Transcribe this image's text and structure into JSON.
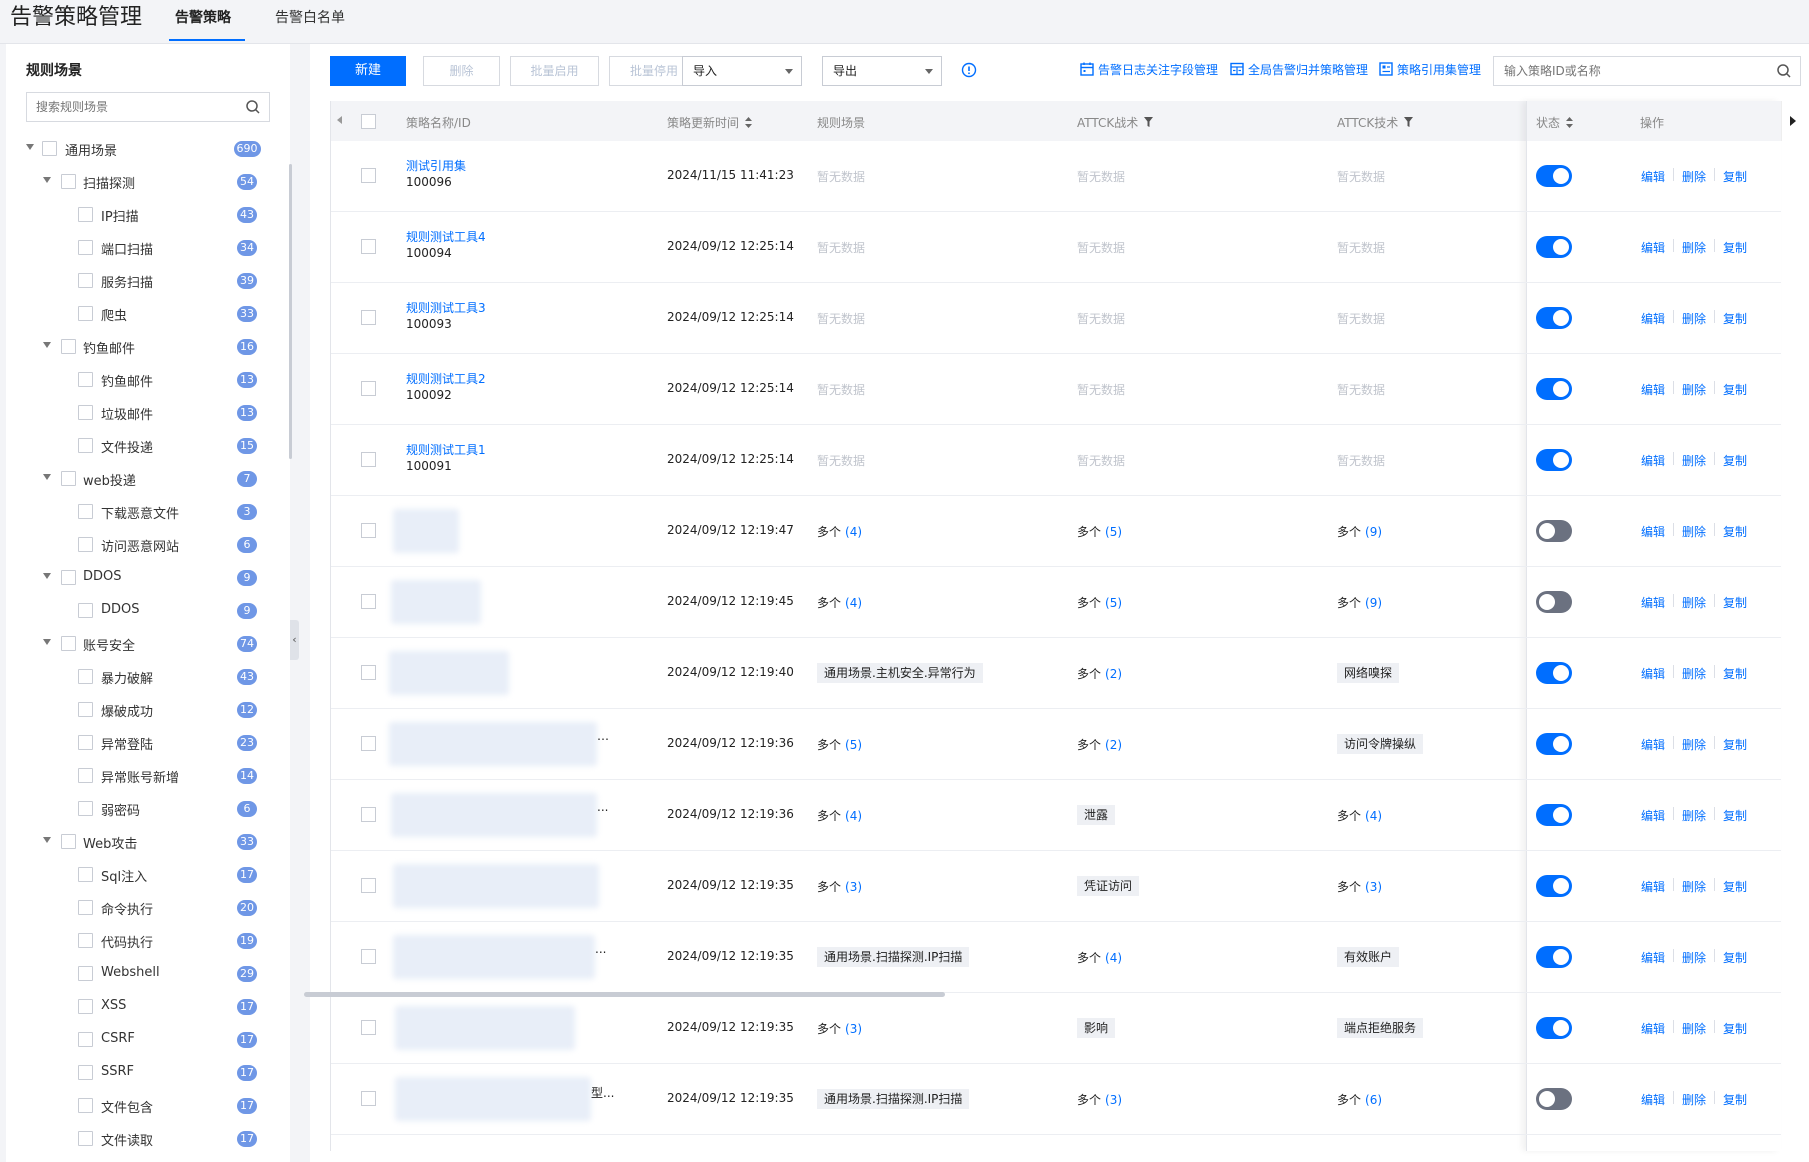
{
  "app_title": "告警策略管理",
  "tabs": [
    {
      "label": "告警策略",
      "active": true
    },
    {
      "label": "告警白名单",
      "active": false
    }
  ],
  "sidebar": {
    "title": "规则场景",
    "search_placeholder": "搜索规则场景",
    "tree": [
      {
        "label": "通用场景",
        "count": "690",
        "level": 0,
        "caret": true
      },
      {
        "label": "扫描探测",
        "count": "54",
        "level": 1,
        "caret": true
      },
      {
        "label": "IP扫描",
        "count": "43",
        "level": 2
      },
      {
        "label": "端口扫描",
        "count": "34",
        "level": 2
      },
      {
        "label": "服务扫描",
        "count": "39",
        "level": 2
      },
      {
        "label": "爬虫",
        "count": "33",
        "level": 2
      },
      {
        "label": "钓鱼邮件",
        "count": "16",
        "level": 1,
        "caret": true
      },
      {
        "label": "钓鱼邮件",
        "count": "13",
        "level": 2
      },
      {
        "label": "垃圾邮件",
        "count": "13",
        "level": 2
      },
      {
        "label": "文件投递",
        "count": "15",
        "level": 2
      },
      {
        "label": "web投递",
        "count": "7",
        "level": 1,
        "caret": true
      },
      {
        "label": "下载恶意文件",
        "count": "3",
        "level": 2
      },
      {
        "label": "访问恶意网站",
        "count": "6",
        "level": 2
      },
      {
        "label": "DDOS",
        "count": "9",
        "level": 1,
        "caret": true
      },
      {
        "label": "DDOS",
        "count": "9",
        "level": 2
      },
      {
        "label": "账号安全",
        "count": "74",
        "level": 1,
        "caret": true
      },
      {
        "label": "暴力破解",
        "count": "43",
        "level": 2
      },
      {
        "label": "爆破成功",
        "count": "12",
        "level": 2
      },
      {
        "label": "异常登陆",
        "count": "23",
        "level": 2
      },
      {
        "label": "异常账号新增",
        "count": "14",
        "level": 2
      },
      {
        "label": "弱密码",
        "count": "6",
        "level": 2
      },
      {
        "label": "Web攻击",
        "count": "33",
        "level": 1,
        "caret": true
      },
      {
        "label": "Sql注入",
        "count": "17",
        "level": 2
      },
      {
        "label": "命令执行",
        "count": "20",
        "level": 2
      },
      {
        "label": "代码执行",
        "count": "19",
        "level": 2
      },
      {
        "label": "Webshell",
        "count": "29",
        "level": 2
      },
      {
        "label": "XSS",
        "count": "17",
        "level": 2
      },
      {
        "label": "CSRF",
        "count": "17",
        "level": 2
      },
      {
        "label": "SSRF",
        "count": "17",
        "level": 2
      },
      {
        "label": "文件包含",
        "count": "17",
        "level": 2
      },
      {
        "label": "文件读取",
        "count": "17",
        "level": 2
      }
    ]
  },
  "toolbar": {
    "new_label": "新建",
    "delete_label": "删除",
    "batch_enable_label": "批量启用",
    "batch_disable_label": "批量停用",
    "import_label": "导入",
    "export_label": "导出",
    "link_field_mgmt": "告警日志关注字段管理",
    "link_merge_mgmt": "全局告警归并策略管理",
    "link_ref_mgmt": "策略引用集管理",
    "search_placeholder": "输入策略ID或名称"
  },
  "table": {
    "columns": {
      "name": "策略名称/ID",
      "updated": "策略更新时间",
      "scene": "规则场景",
      "tactic": "ATTCK战术",
      "technique": "ATTCK技术",
      "status": "状态",
      "actions": "操作"
    },
    "action_labels": {
      "edit": "编辑",
      "delete": "删除",
      "copy": "复制"
    },
    "nodata": "暂无数据",
    "multi_prefix": "多个",
    "rows": [
      {
        "name": "测试引用集",
        "id": "100096",
        "time": "2024/11/15 11:41:23",
        "scene": {
          "nodata": true
        },
        "tactic": {
          "nodata": true
        },
        "tech": {
          "nodata": true
        },
        "on": true
      },
      {
        "name": "规则测试工具4",
        "id": "100094",
        "time": "2024/09/12 12:25:14",
        "scene": {
          "nodata": true
        },
        "tactic": {
          "nodata": true
        },
        "tech": {
          "nodata": true
        },
        "on": true
      },
      {
        "name": "规则测试工具3",
        "id": "100093",
        "time": "2024/09/12 12:25:14",
        "scene": {
          "nodata": true
        },
        "tactic": {
          "nodata": true
        },
        "tech": {
          "nodata": true
        },
        "on": true
      },
      {
        "name": "规则测试工具2",
        "id": "100092",
        "time": "2024/09/12 12:25:14",
        "scene": {
          "nodata": true
        },
        "tactic": {
          "nodata": true
        },
        "tech": {
          "nodata": true
        },
        "on": true
      },
      {
        "name": "规则测试工具1",
        "id": "100091",
        "time": "2024/09/12 12:25:14",
        "scene": {
          "nodata": true
        },
        "tactic": {
          "nodata": true
        },
        "tech": {
          "nodata": true
        },
        "on": true
      },
      {
        "time": "2024/09/12 12:19:47",
        "scene": {
          "multi": "(4)"
        },
        "tactic": {
          "multi": "(5)"
        },
        "tech": {
          "multi": "(9)"
        },
        "on": false,
        "blur": [
          62,
          66
        ],
        "suffix": ""
      },
      {
        "time": "2024/09/12 12:19:45",
        "scene": {
          "multi": "(4)"
        },
        "tactic": {
          "multi": "(5)"
        },
        "tech": {
          "multi": "(9)"
        },
        "on": false,
        "blur": [
          60,
          90
        ],
        "suffix": ""
      },
      {
        "time": "2024/09/12 12:19:40",
        "scene": {
          "tag": "通用场景.主机安全.异常行为"
        },
        "tactic": {
          "multi": "(2)"
        },
        "tech": {
          "tag": "网络嗅探"
        },
        "on": true,
        "blur": [
          58,
          120
        ],
        "suffix": ""
      },
      {
        "time": "2024/09/12 12:19:36",
        "scene": {
          "multi": "(5)"
        },
        "tactic": {
          "multi": "(2)"
        },
        "tech": {
          "tag": "访问令牌操纵"
        },
        "on": true,
        "blur": [
          58,
          208
        ],
        "suffix": "…"
      },
      {
        "time": "2024/09/12 12:19:36",
        "scene": {
          "multi": "(4)"
        },
        "tactic": {
          "tag": "泄露"
        },
        "tech": {
          "multi": "(4)"
        },
        "on": true,
        "blur": [
          60,
          206
        ],
        "suffix": "..."
      },
      {
        "time": "2024/09/12 12:19:35",
        "scene": {
          "multi": "(3)"
        },
        "tactic": {
          "tag": "凭证访问"
        },
        "tech": {
          "multi": "(3)"
        },
        "on": true,
        "blur": [
          62,
          206
        ],
        "suffix": ""
      },
      {
        "time": "2024/09/12 12:19:35",
        "scene": {
          "tag": "通用场景.扫描探测.IP扫描"
        },
        "tactic": {
          "multi": "(4)"
        },
        "tech": {
          "tag": "有效账户"
        },
        "on": true,
        "blur": [
          62,
          202
        ],
        "suffix": "..."
      },
      {
        "time": "2024/09/12 12:19:35",
        "scene": {
          "multi": "(3)"
        },
        "tactic": {
          "tag": "影响"
        },
        "tech": {
          "tag": "端点拒绝服务"
        },
        "on": true,
        "blur": [
          64,
          180
        ],
        "suffix": ""
      },
      {
        "time": "2024/09/12 12:19:35",
        "scene": {
          "tag": "通用场景.扫描探测.IP扫描"
        },
        "tactic": {
          "multi": "(3)"
        },
        "tech": {
          "multi": "(6)"
        },
        "on": false,
        "blur": [
          64,
          196
        ],
        "suffix": "型..."
      }
    ]
  },
  "colors": {
    "primary": "#006eff",
    "badge": "#6f97e6",
    "toggle_off": "#6b7180"
  },
  "icons": {
    "search": "search-icon",
    "info": "info-icon",
    "calendar": "calendar-icon",
    "merge": "table-icon",
    "ref": "list-icon"
  }
}
